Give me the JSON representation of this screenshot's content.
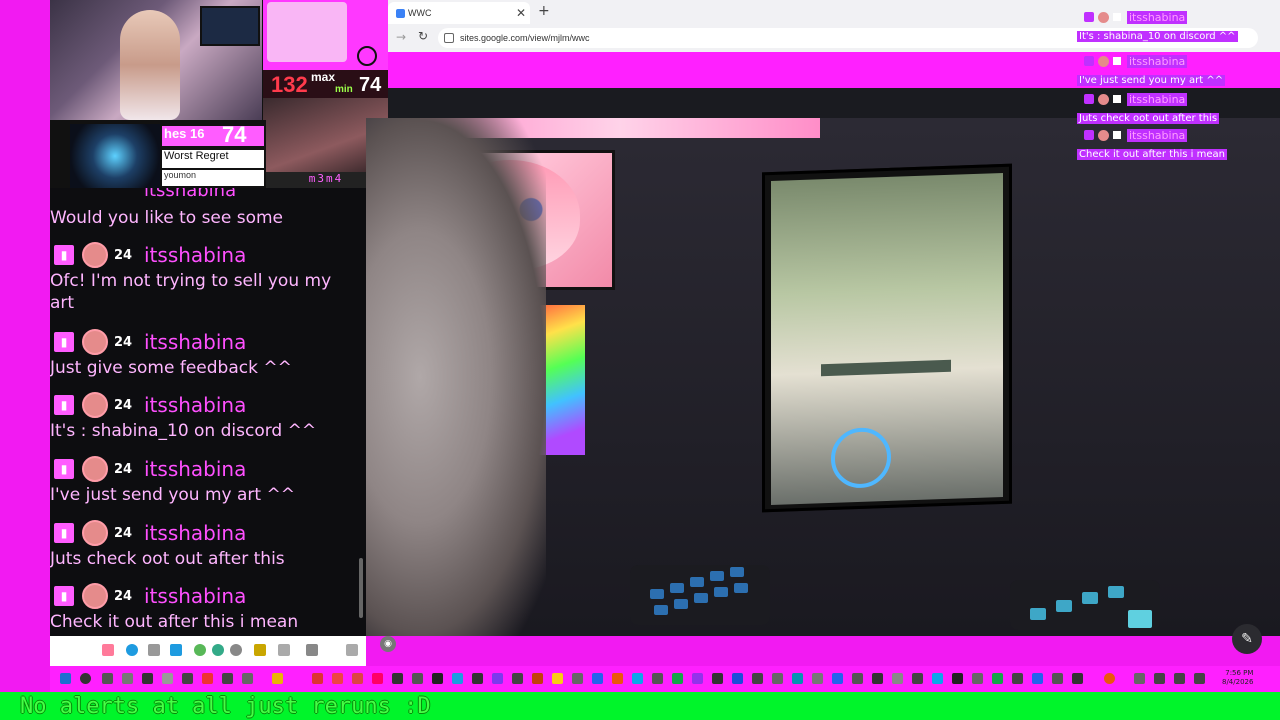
{
  "browser": {
    "tab_title": "WWC",
    "tab_close": "✕",
    "new_tab": "+",
    "url": "sites.google.com/view/mjlm/wwc"
  },
  "widgets": {
    "heart_rate": {
      "bpm": "132",
      "max_label": "max",
      "min_label": "min",
      "value": "74"
    },
    "channel_name": "m3m4",
    "song": {
      "top_label": "hes 16",
      "number": "74",
      "title": "Worst Regret",
      "artist": "youmon"
    }
  },
  "chat": {
    "partial_user": "itsshabina",
    "messages": [
      {
        "user": "",
        "text": "Would you like to see some"
      },
      {
        "user": "itsshabina",
        "level": "24",
        "text": "Ofc! I'm not trying to sell you my art"
      },
      {
        "user": "itsshabina",
        "level": "24",
        "text": "Just give some feedback ^^"
      },
      {
        "user": "itsshabina",
        "level": "24",
        "text": "It's : shabina_10 on discord ^^"
      },
      {
        "user": "itsshabina",
        "level": "24",
        "text": "I've just send you my art ^^"
      },
      {
        "user": "itsshabina",
        "level": "24",
        "text": "Juts check oot out after this"
      },
      {
        "user": "itsshabina",
        "level": "24",
        "text": "Check it out after this i mean"
      }
    ]
  },
  "overlay_chat": [
    {
      "user": "itsshabina",
      "text": "It's : shabina_10 on discord ^^"
    },
    {
      "user": "itsshabina",
      "text": "I've just send you my art ^^"
    },
    {
      "user": "itsshabina",
      "text": "Juts check oot out after this"
    },
    {
      "user": "itsshabina",
      "text": "Check it out after this i mean"
    }
  ],
  "taskbar": {
    "time": "7:56 PM",
    "date": "8/4/2026"
  },
  "alert_bar": {
    "text": "No alerts at all just reruns :D"
  },
  "colors": {
    "accent": "#ff20ff",
    "chat_name": "#ff50ff",
    "alert_green": "#00f52a"
  },
  "icons": {
    "edit": "pencil-icon",
    "view": "camera-icon"
  }
}
